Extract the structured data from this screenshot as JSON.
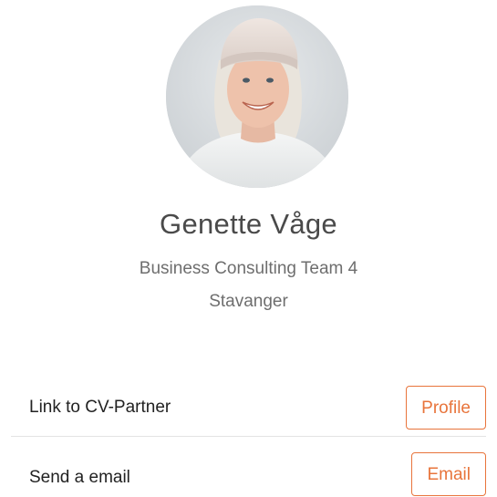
{
  "profile": {
    "name": "Genette Våge",
    "team": "Business Consulting Team 4",
    "location": "Stavanger"
  },
  "links": [
    {
      "label": "Link to CV-Partner",
      "button": "Profile"
    },
    {
      "label": "Send a email",
      "button": "Email"
    }
  ],
  "colors": {
    "accent": "#e8743b",
    "name_text": "#4a4a4a",
    "secondary_text": "#6e6e6e",
    "divider": "#e3e3e3"
  }
}
